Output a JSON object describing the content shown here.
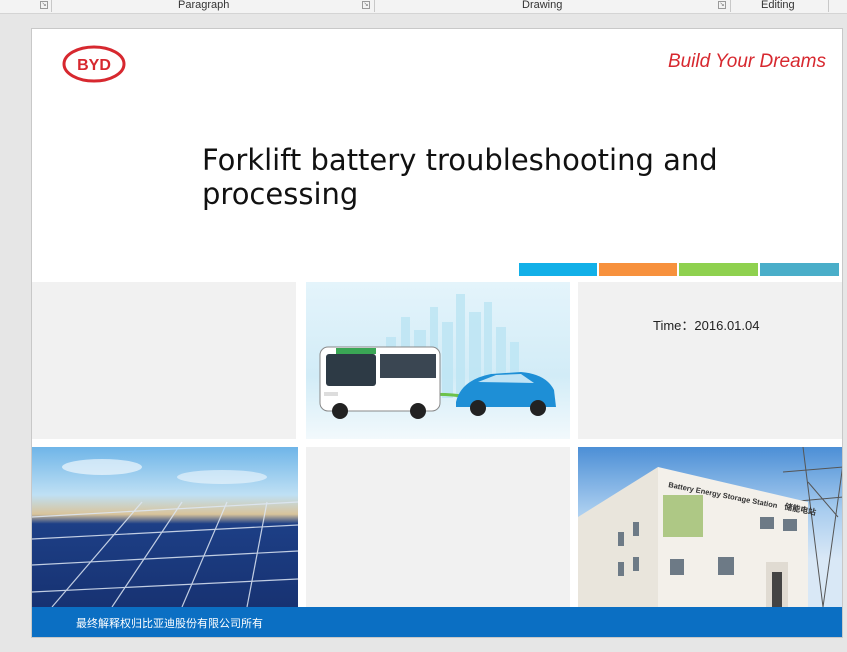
{
  "ribbon": {
    "groups": [
      {
        "label": "Paragraph"
      },
      {
        "label": "Drawing"
      },
      {
        "label": "Editing"
      }
    ]
  },
  "slide": {
    "logo_text": "BYD",
    "tagline": "Build Your Dreams",
    "title": "Forklift battery troubleshooting and processing",
    "time_label": "Time：",
    "time_value": "2016.01.04",
    "building_sign_en": "Battery Energy Storage Station",
    "building_sign_cn": "储能电站",
    "footer_text": "最终解释权归比亚迪股份有限公司所有",
    "stripe_colors": [
      "#12b0e8",
      "#f7913d",
      "#8fd14f",
      "#4aaec9"
    ],
    "brand_red": "#d7282f",
    "footer_blue": "#0b6fc3"
  }
}
